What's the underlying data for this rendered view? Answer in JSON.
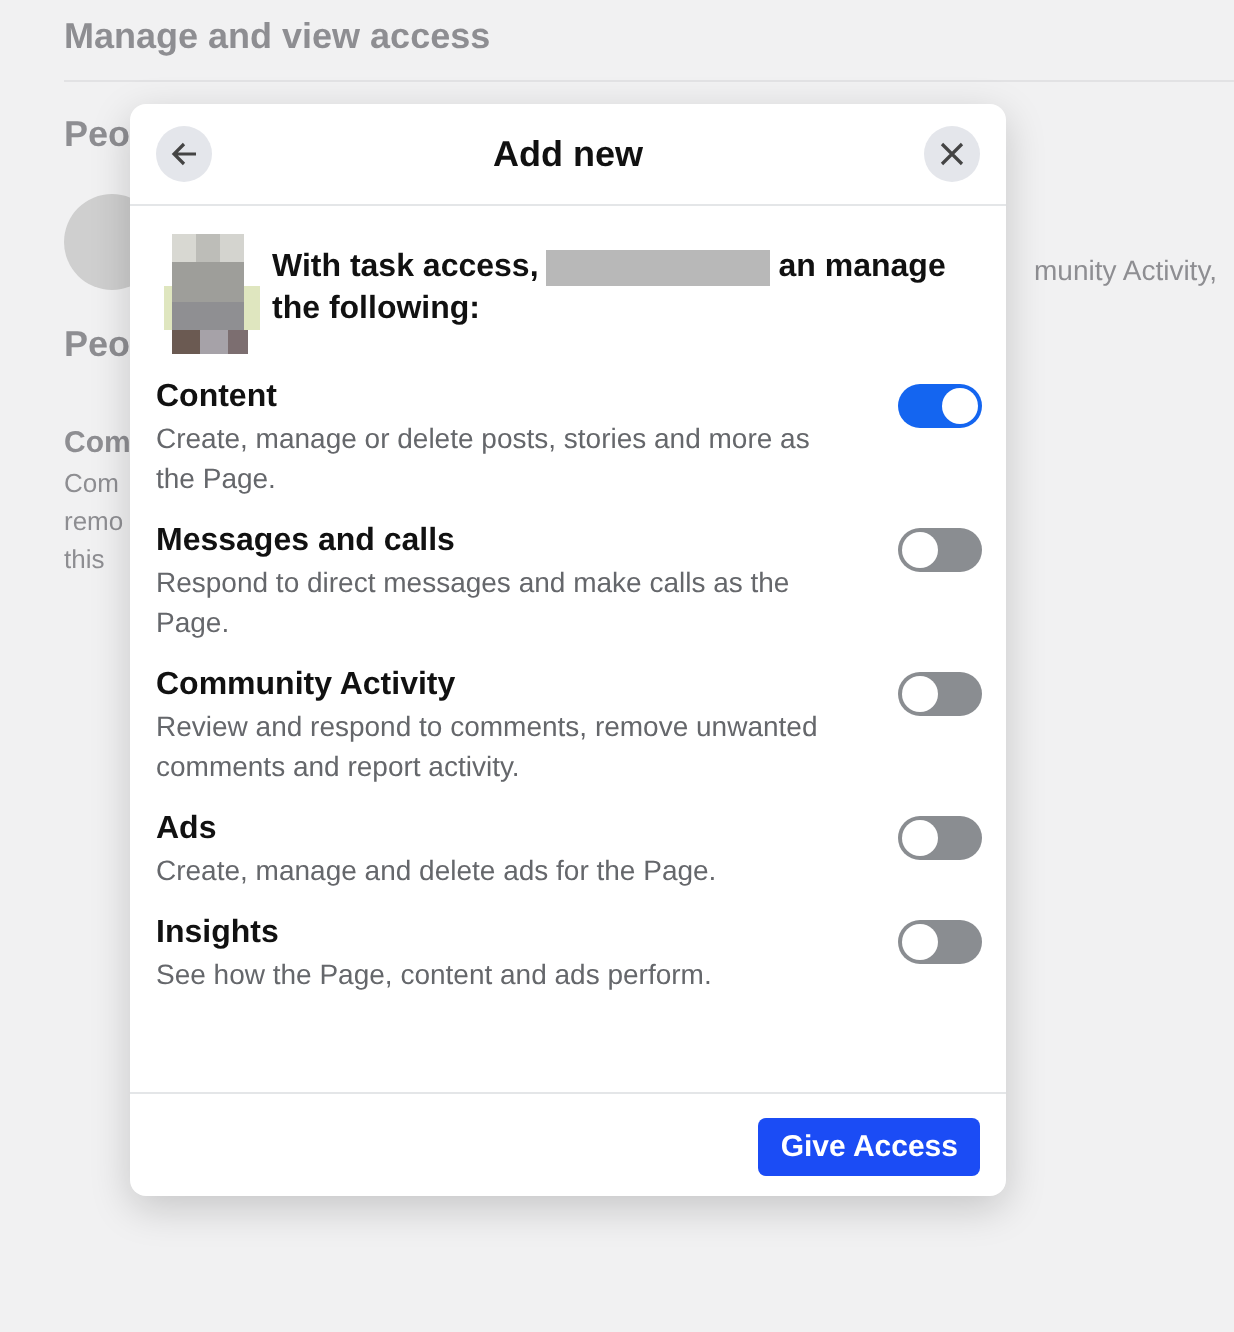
{
  "background": {
    "title": "Manage and view access",
    "sections": [
      {
        "heading": "Peo"
      },
      {
        "heading": "Peo"
      }
    ],
    "side_text": "munity Activity,",
    "item": {
      "title": "Com",
      "lines": [
        "Com",
        "remo",
        "this"
      ]
    }
  },
  "dialog": {
    "title": "Add new",
    "intro": {
      "before": "With task access,",
      "after": "an manage",
      "second_line": "the following:"
    },
    "permissions": [
      {
        "title": "Content",
        "description": "Create, manage or delete posts, stories and more as the Page.",
        "on": true
      },
      {
        "title": "Messages and calls",
        "description": "Respond to direct messages and make calls as the Page.",
        "on": false
      },
      {
        "title": "Community Activity",
        "description": "Review and respond to comments, remove unwanted comments and report activity.",
        "on": false
      },
      {
        "title": "Ads",
        "description": "Create, manage and delete ads for the Page.",
        "on": false
      },
      {
        "title": "Insights",
        "description": "See how the Page, content and ads perform.",
        "on": false
      }
    ],
    "button": "Give Access"
  }
}
